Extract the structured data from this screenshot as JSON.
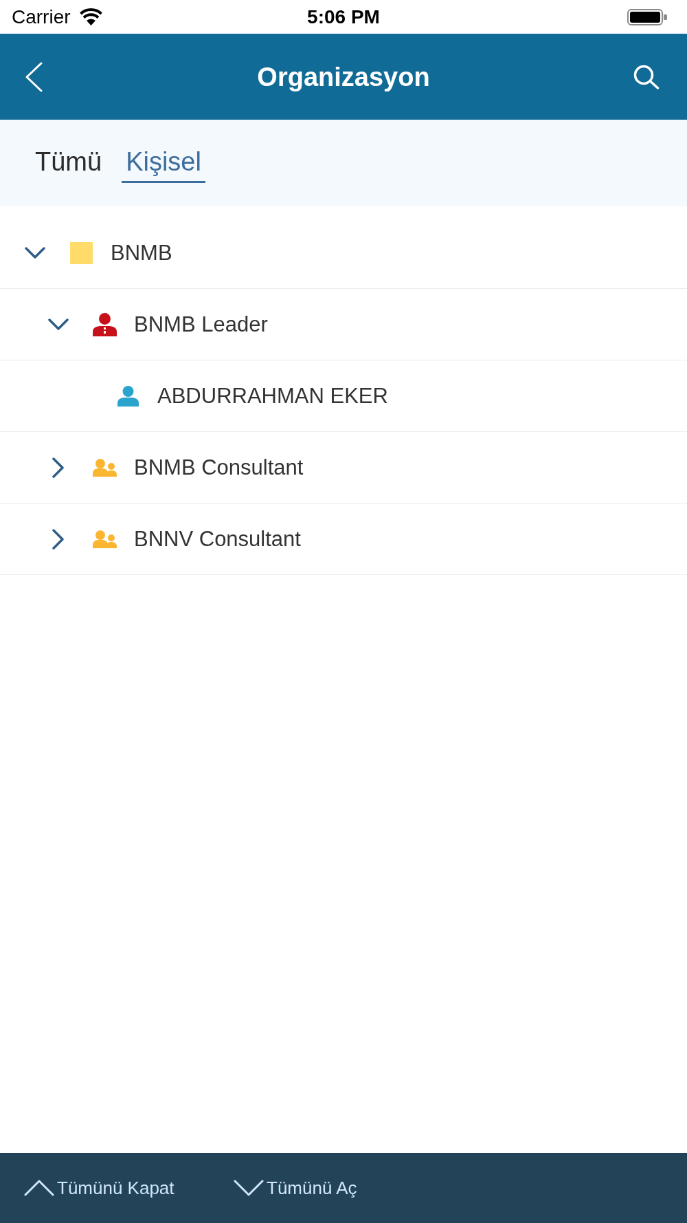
{
  "status_bar": {
    "carrier": "Carrier",
    "time": "5:06 PM"
  },
  "nav_bar": {
    "title": "Organizasyon"
  },
  "tabs": [
    {
      "label": "Tümü",
      "selected": false
    },
    {
      "label": "Kişisel",
      "selected": true
    }
  ],
  "tree": [
    {
      "label": "BNMB",
      "kind": "organization",
      "expanded": true,
      "children": [
        {
          "label": "BNMB Leader",
          "kind": "leader",
          "expanded": true,
          "children": [
            {
              "label": "ABDURRAHMAN EKER",
              "kind": "person"
            }
          ]
        },
        {
          "label": "BNMB Consultant",
          "kind": "group",
          "expanded": false
        },
        {
          "label": "BNNV Consultant",
          "kind": "group",
          "expanded": false
        }
      ]
    }
  ],
  "bottom_bar": {
    "buttons": [
      {
        "label": "Tümünü Kapat",
        "kind": "collapse"
      },
      {
        "label": "Tümünü Aç",
        "kind": "expand"
      }
    ]
  }
}
